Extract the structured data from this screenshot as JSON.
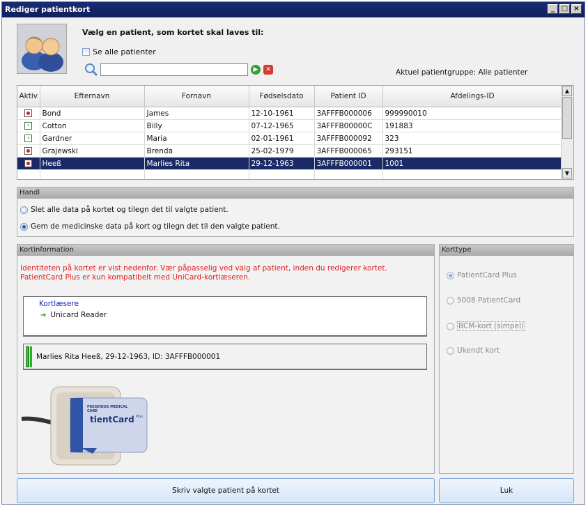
{
  "window": {
    "title": "Rediger patientkort"
  },
  "header": {
    "prompt": "Vælg en patient, som kortet skal laves til:",
    "show_all_label": "Se alle patienter",
    "search_value": "",
    "group_label": "Aktuel patientgruppe: Alle patienter"
  },
  "table": {
    "columns": [
      "Aktiv",
      "Efternavn",
      "Fornavn",
      "Fødselsdato",
      "Patient ID",
      "Afdelings-ID"
    ],
    "rows": [
      {
        "status": "record",
        "last": "Bond",
        "first": "James",
        "dob": "12-10-1961",
        "pid": "3AFFFB000006",
        "dept": "999990010"
      },
      {
        "status": "arrow",
        "last": "Cotton",
        "first": "Billy",
        "dob": "07-12-1965",
        "pid": "3AFFFB00000C",
        "dept": "191883"
      },
      {
        "status": "arrow",
        "last": "Gardner",
        "first": "Maria",
        "dob": "02-01-1961",
        "pid": "3AFFFB000092",
        "dept": "323"
      },
      {
        "status": "record",
        "last": "Grajewski",
        "first": "Brenda",
        "dob": "25-02-1979",
        "pid": "3AFFFB000065",
        "dept": "293151"
      },
      {
        "status": "record",
        "last": "Heeß",
        "first": "Marlies Rita",
        "dob": "29-12-1963",
        "pid": "3AFFFB000001",
        "dept": "1001",
        "selected": true
      }
    ]
  },
  "handl": {
    "title": "Handl",
    "opt1": "Slet alle data på kortet og tilegn det til valgte patient.",
    "opt2": "Gem de medicinske data på kort og tilegn det til den valgte patient."
  },
  "kortinfo": {
    "title": "Kortinformation",
    "warning": "Identiteten på kortet er vist nedenfor. Vær påpasselig ved valg af patient, inden du redigerer kortet. PatientCard Plus er kun kompatibelt med UniCard-kortlæseren.",
    "tree_root": "Kortlæsere",
    "tree_child": "Unicard Reader",
    "card_text": "Marlies Rita Heeß, 29-12-1963, ID: 3AFFFB000001",
    "card_brand_top": "FRESENIUS MEDICAL CARE",
    "card_brand_name": "tientCard",
    "card_brand_plus": "Plus"
  },
  "korttype": {
    "title": "Korttype",
    "options": [
      "PatientCard Plus",
      "5008 PatientCard",
      "BCM-kort (simpel)",
      "Ukendt kort"
    ]
  },
  "buttons": {
    "write": "Skriv valgte patient på kortet",
    "close": "Luk"
  },
  "colors": {
    "title_bar": "#0f1e5e",
    "selection": "#1a2a66",
    "warning": "#e02020",
    "link": "#1a2ac8"
  }
}
